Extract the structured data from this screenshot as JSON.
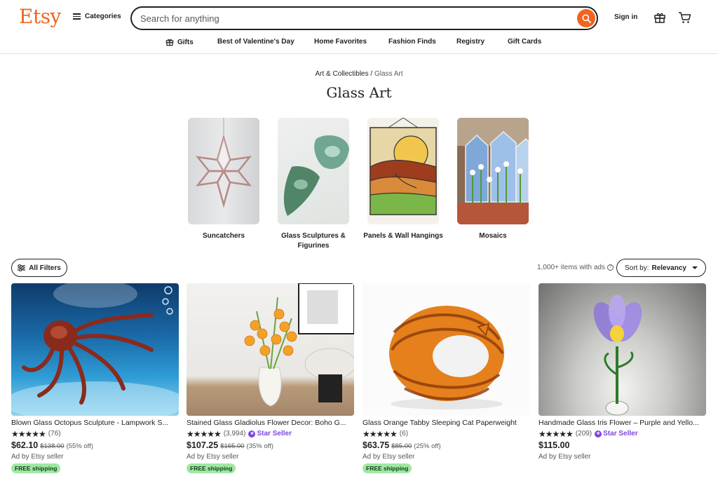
{
  "header": {
    "logo": "Etsy",
    "categories_label": "Categories",
    "search_placeholder": "Search for anything",
    "signin_label": "Sign in",
    "nav": [
      {
        "label": "Gifts",
        "icon": "gift-icon"
      },
      {
        "label": "Best of Valentine's Day"
      },
      {
        "label": "Home Favorites"
      },
      {
        "label": "Fashion Finds"
      },
      {
        "label": "Registry"
      },
      {
        "label": "Gift Cards"
      }
    ]
  },
  "breadcrumb": {
    "parent": "Art & Collectibles",
    "separator": "/",
    "current": "Glass Art"
  },
  "page_title": "Glass Art",
  "categories": [
    {
      "label": "Suncatchers"
    },
    {
      "label": "Glass Sculptures & Figurines"
    },
    {
      "label": "Panels & Wall Hangings"
    },
    {
      "label": "Mosaics"
    }
  ],
  "filters": {
    "all_filters_label": "All Filters",
    "result_count": "1,000+ items with ads",
    "sort_prefix": "Sort by:",
    "sort_value": "Relevancy"
  },
  "products": [
    {
      "title": "Blown Glass Octopus Sculpture - Lampwork S...",
      "stars": "★★★★★",
      "reviews": "(76)",
      "star_seller": "",
      "price": "$62.10",
      "original_price": "$138.00",
      "discount": "(55% off)",
      "ad_text": "Ad by Etsy seller",
      "shipping": "FREE shipping"
    },
    {
      "title": "Stained Glass Gladiolus Flower Decor: Boho G...",
      "stars": "★★★★★",
      "reviews": "(3,994)",
      "star_seller": "Star Seller",
      "price": "$107.25",
      "original_price": "$165.00",
      "discount": "(35% off)",
      "ad_text": "Ad by Etsy seller",
      "shipping": "FREE shipping"
    },
    {
      "title": "Glass Orange Tabby Sleeping Cat Paperweight",
      "stars": "★★★★★",
      "reviews": "(6)",
      "star_seller": "",
      "price": "$63.75",
      "original_price": "$85.00",
      "discount": "(25% off)",
      "ad_text": "Ad by Etsy seller",
      "shipping": "FREE shipping"
    },
    {
      "title": "Handmade Glass Iris Flower – Purple and Yello...",
      "stars": "★★★★★",
      "reviews": "(209)",
      "star_seller": "Star Seller",
      "price": "$115.00",
      "original_price": "",
      "discount": "",
      "ad_text": "Ad by Etsy seller",
      "shipping": ""
    }
  ],
  "colors": {
    "brand": "#F1641E",
    "star_seller": "#7f47dd",
    "free_shipping_bg": "#9ee8a3"
  }
}
